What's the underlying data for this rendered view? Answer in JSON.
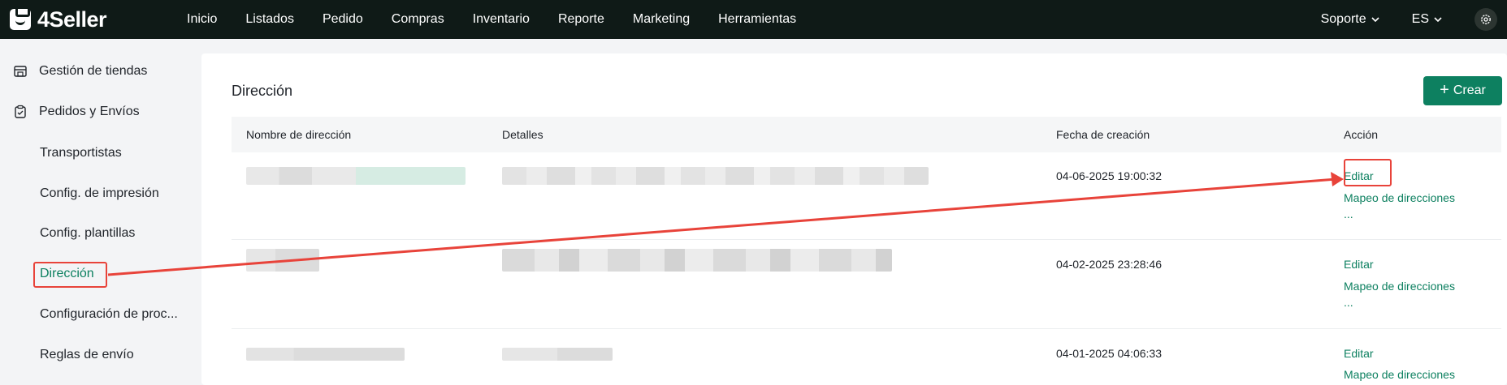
{
  "topbar": {
    "brand": "4Seller",
    "nav": [
      "Inicio",
      "Listados",
      "Pedido",
      "Compras",
      "Inventario",
      "Reporte",
      "Marketing",
      "Herramientas"
    ],
    "support_label": "Soporte",
    "language_label": "ES"
  },
  "sidebar": {
    "groups": [
      {
        "label": "Gestión de tiendas",
        "icon": "store-icon"
      },
      {
        "label": "Pedidos y Envíos",
        "icon": "clipboard-icon"
      }
    ],
    "items": [
      {
        "label": "Transportistas",
        "active": false
      },
      {
        "label": "Config. de impresión",
        "active": false
      },
      {
        "label": "Config. plantillas",
        "active": false
      },
      {
        "label": "Dirección",
        "active": true
      },
      {
        "label": "Configuración de proc...",
        "active": false
      },
      {
        "label": "Reglas de envío",
        "active": false
      }
    ]
  },
  "main": {
    "title": "Dirección",
    "create_button": "Crear",
    "columns": [
      "Nombre de dirección",
      "Detalles",
      "Fecha de creación",
      "Acción"
    ],
    "rows": [
      {
        "created": "04-06-2025 19:00:32",
        "actions": [
          "Editar",
          "Mapeo de direcciones",
          "..."
        ]
      },
      {
        "created": "04-02-2025 23:28:46",
        "actions": [
          "Editar",
          "Mapeo de direcciones",
          "..."
        ]
      },
      {
        "created": "04-01-2025 04:06:33",
        "actions": [
          "Editar",
          "Mapeo de direcciones"
        ]
      }
    ]
  },
  "colors": {
    "accent": "#0d8060",
    "topbar_bg": "#0f1a17",
    "annotation": "#e8433a"
  }
}
